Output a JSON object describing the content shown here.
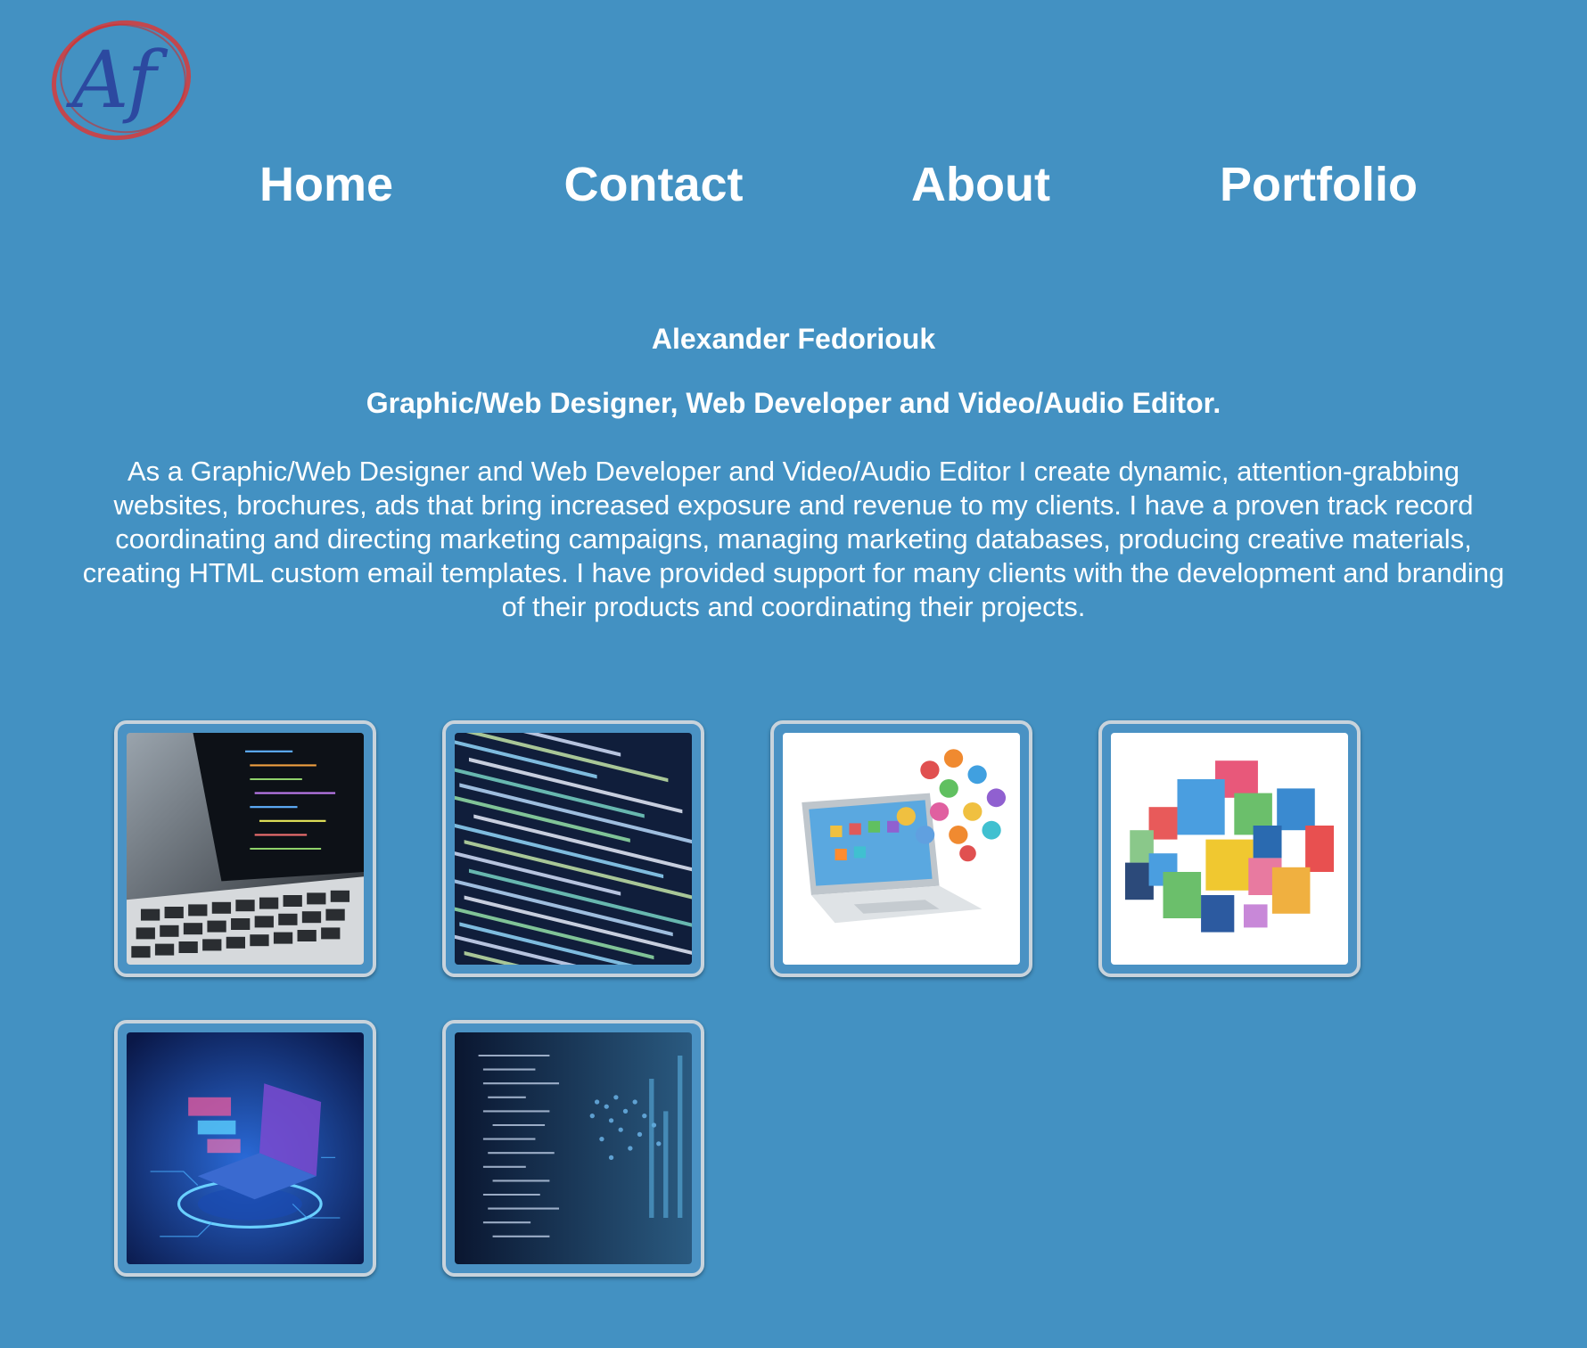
{
  "logo": {
    "text": "Af",
    "colors": {
      "letters": "#2c49a0",
      "ring": "#d83a3a"
    }
  },
  "nav": [
    {
      "label": "Home"
    },
    {
      "label": "Contact"
    },
    {
      "label": "About"
    },
    {
      "label": "Portfolio"
    }
  ],
  "hero": {
    "name": "Alexander Fedoriouk",
    "title": "Graphic/Web Designer, Web Developer and Video/Audio Editor.",
    "bio": "As a Graphic/Web Designer and Web Developer and Video/Audio Editor I create dynamic, attention-grabbing websites, brochures, ads that bring increased exposure and revenue to my clients. I have a proven track record coordinating and directing marketing campaigns, managing marketing databases, producing creative materials, creating HTML custom email templates. I have provided support for many clients with the development and branding of their products and coordinating their projects."
  },
  "gallery": [
    {
      "image": "laptop-code-photo"
    },
    {
      "image": "code-closeup-photo"
    },
    {
      "image": "laptop-app-icons-illustration"
    },
    {
      "image": "web-technology-logos-illustration"
    },
    {
      "image": "isometric-laptop-illustration"
    },
    {
      "image": "world-map-code-photo"
    }
  ],
  "colors": {
    "background": "#4391c2",
    "text": "#ffffff",
    "thumb_border": "#c8d3dc"
  }
}
